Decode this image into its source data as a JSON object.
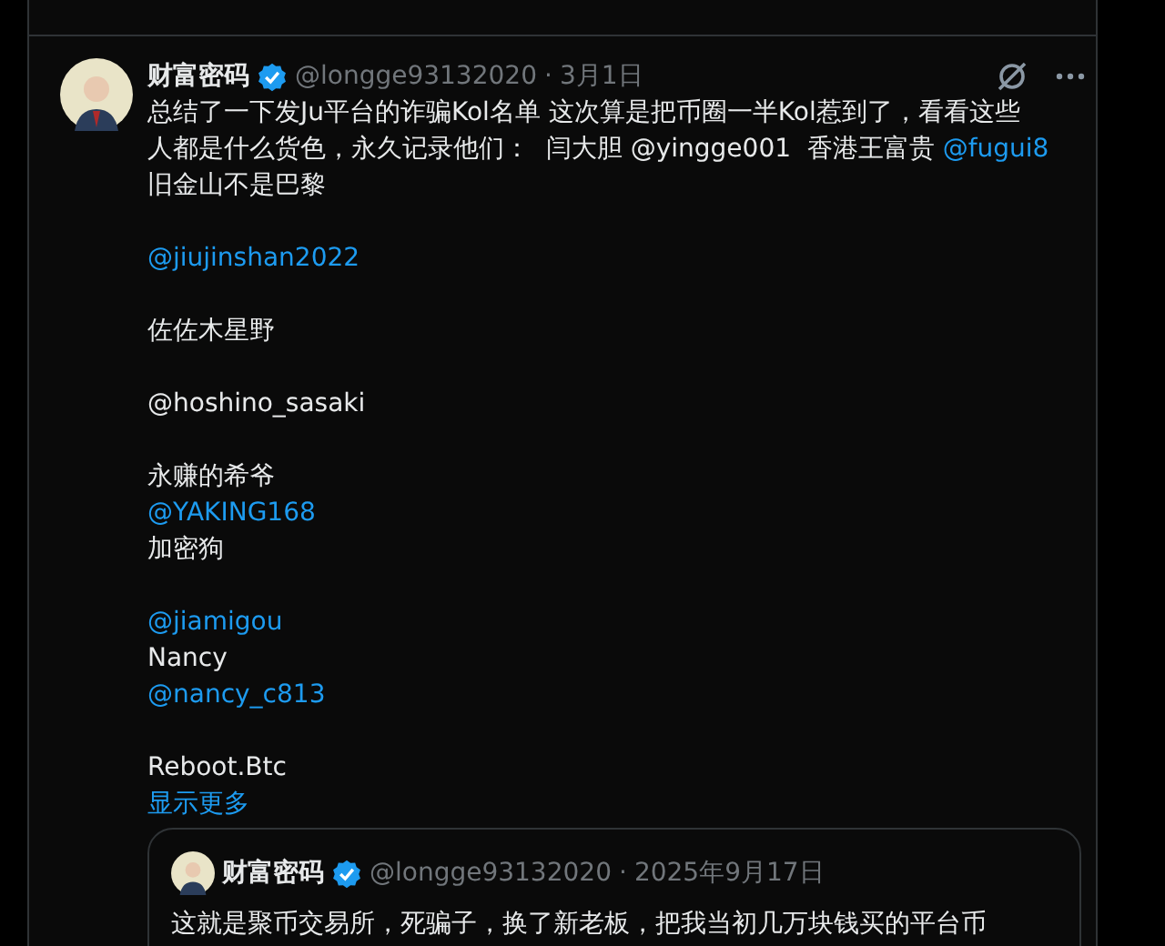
{
  "post": {
    "author": "财富密码",
    "verified": true,
    "handle": "@longge93132020",
    "separator": "·",
    "date": "3月1日",
    "paragraphs": [
      {
        "lines": [
          [
            {
              "kind": "text",
              "text": "总结了一下发Ju平台的诈骗Kol名单 这次算是把币圈一半Kol惹到了，看看这些"
            }
          ],
          [
            {
              "kind": "text",
              "text": "人都是什么货色，永久记录他们：  闫大胆 @yingge001  香港王富贵 "
            },
            {
              "kind": "mention",
              "text": "@fugui8"
            }
          ],
          [
            {
              "kind": "text",
              "text": "旧金山不是巴黎"
            }
          ]
        ]
      },
      {
        "lines": [
          [
            {
              "kind": "mention",
              "text": "@jiujinshan2022"
            }
          ]
        ]
      },
      {
        "lines": [
          [
            {
              "kind": "text",
              "text": "佐佐木星野"
            }
          ]
        ]
      },
      {
        "lines": [
          [
            {
              "kind": "text",
              "text": "@hoshino_sasaki"
            }
          ]
        ]
      },
      {
        "lines": [
          [
            {
              "kind": "text",
              "text": "永赚的希爷"
            }
          ],
          [
            {
              "kind": "mention",
              "text": "@YAKING168"
            }
          ],
          [
            {
              "kind": "text",
              "text": "加密狗"
            }
          ]
        ]
      },
      {
        "lines": [
          [
            {
              "kind": "mention",
              "text": "@jiamigou"
            }
          ],
          [
            {
              "kind": "text",
              "text": "Nancy"
            }
          ],
          [
            {
              "kind": "mention",
              "text": "@nancy_c813"
            }
          ]
        ]
      },
      {
        "lines": [
          [
            {
              "kind": "text",
              "text": "Reboot.Btc"
            }
          ]
        ]
      }
    ],
    "show_more": "显示更多",
    "quote": {
      "author": "财富密码",
      "verified": true,
      "handle": "@longge93132020",
      "separator": "·",
      "date": "2025年9月17日",
      "text": "这就是聚币交易所，死骗子，换了新老板，把我当初几万块钱买的平台币"
    }
  }
}
